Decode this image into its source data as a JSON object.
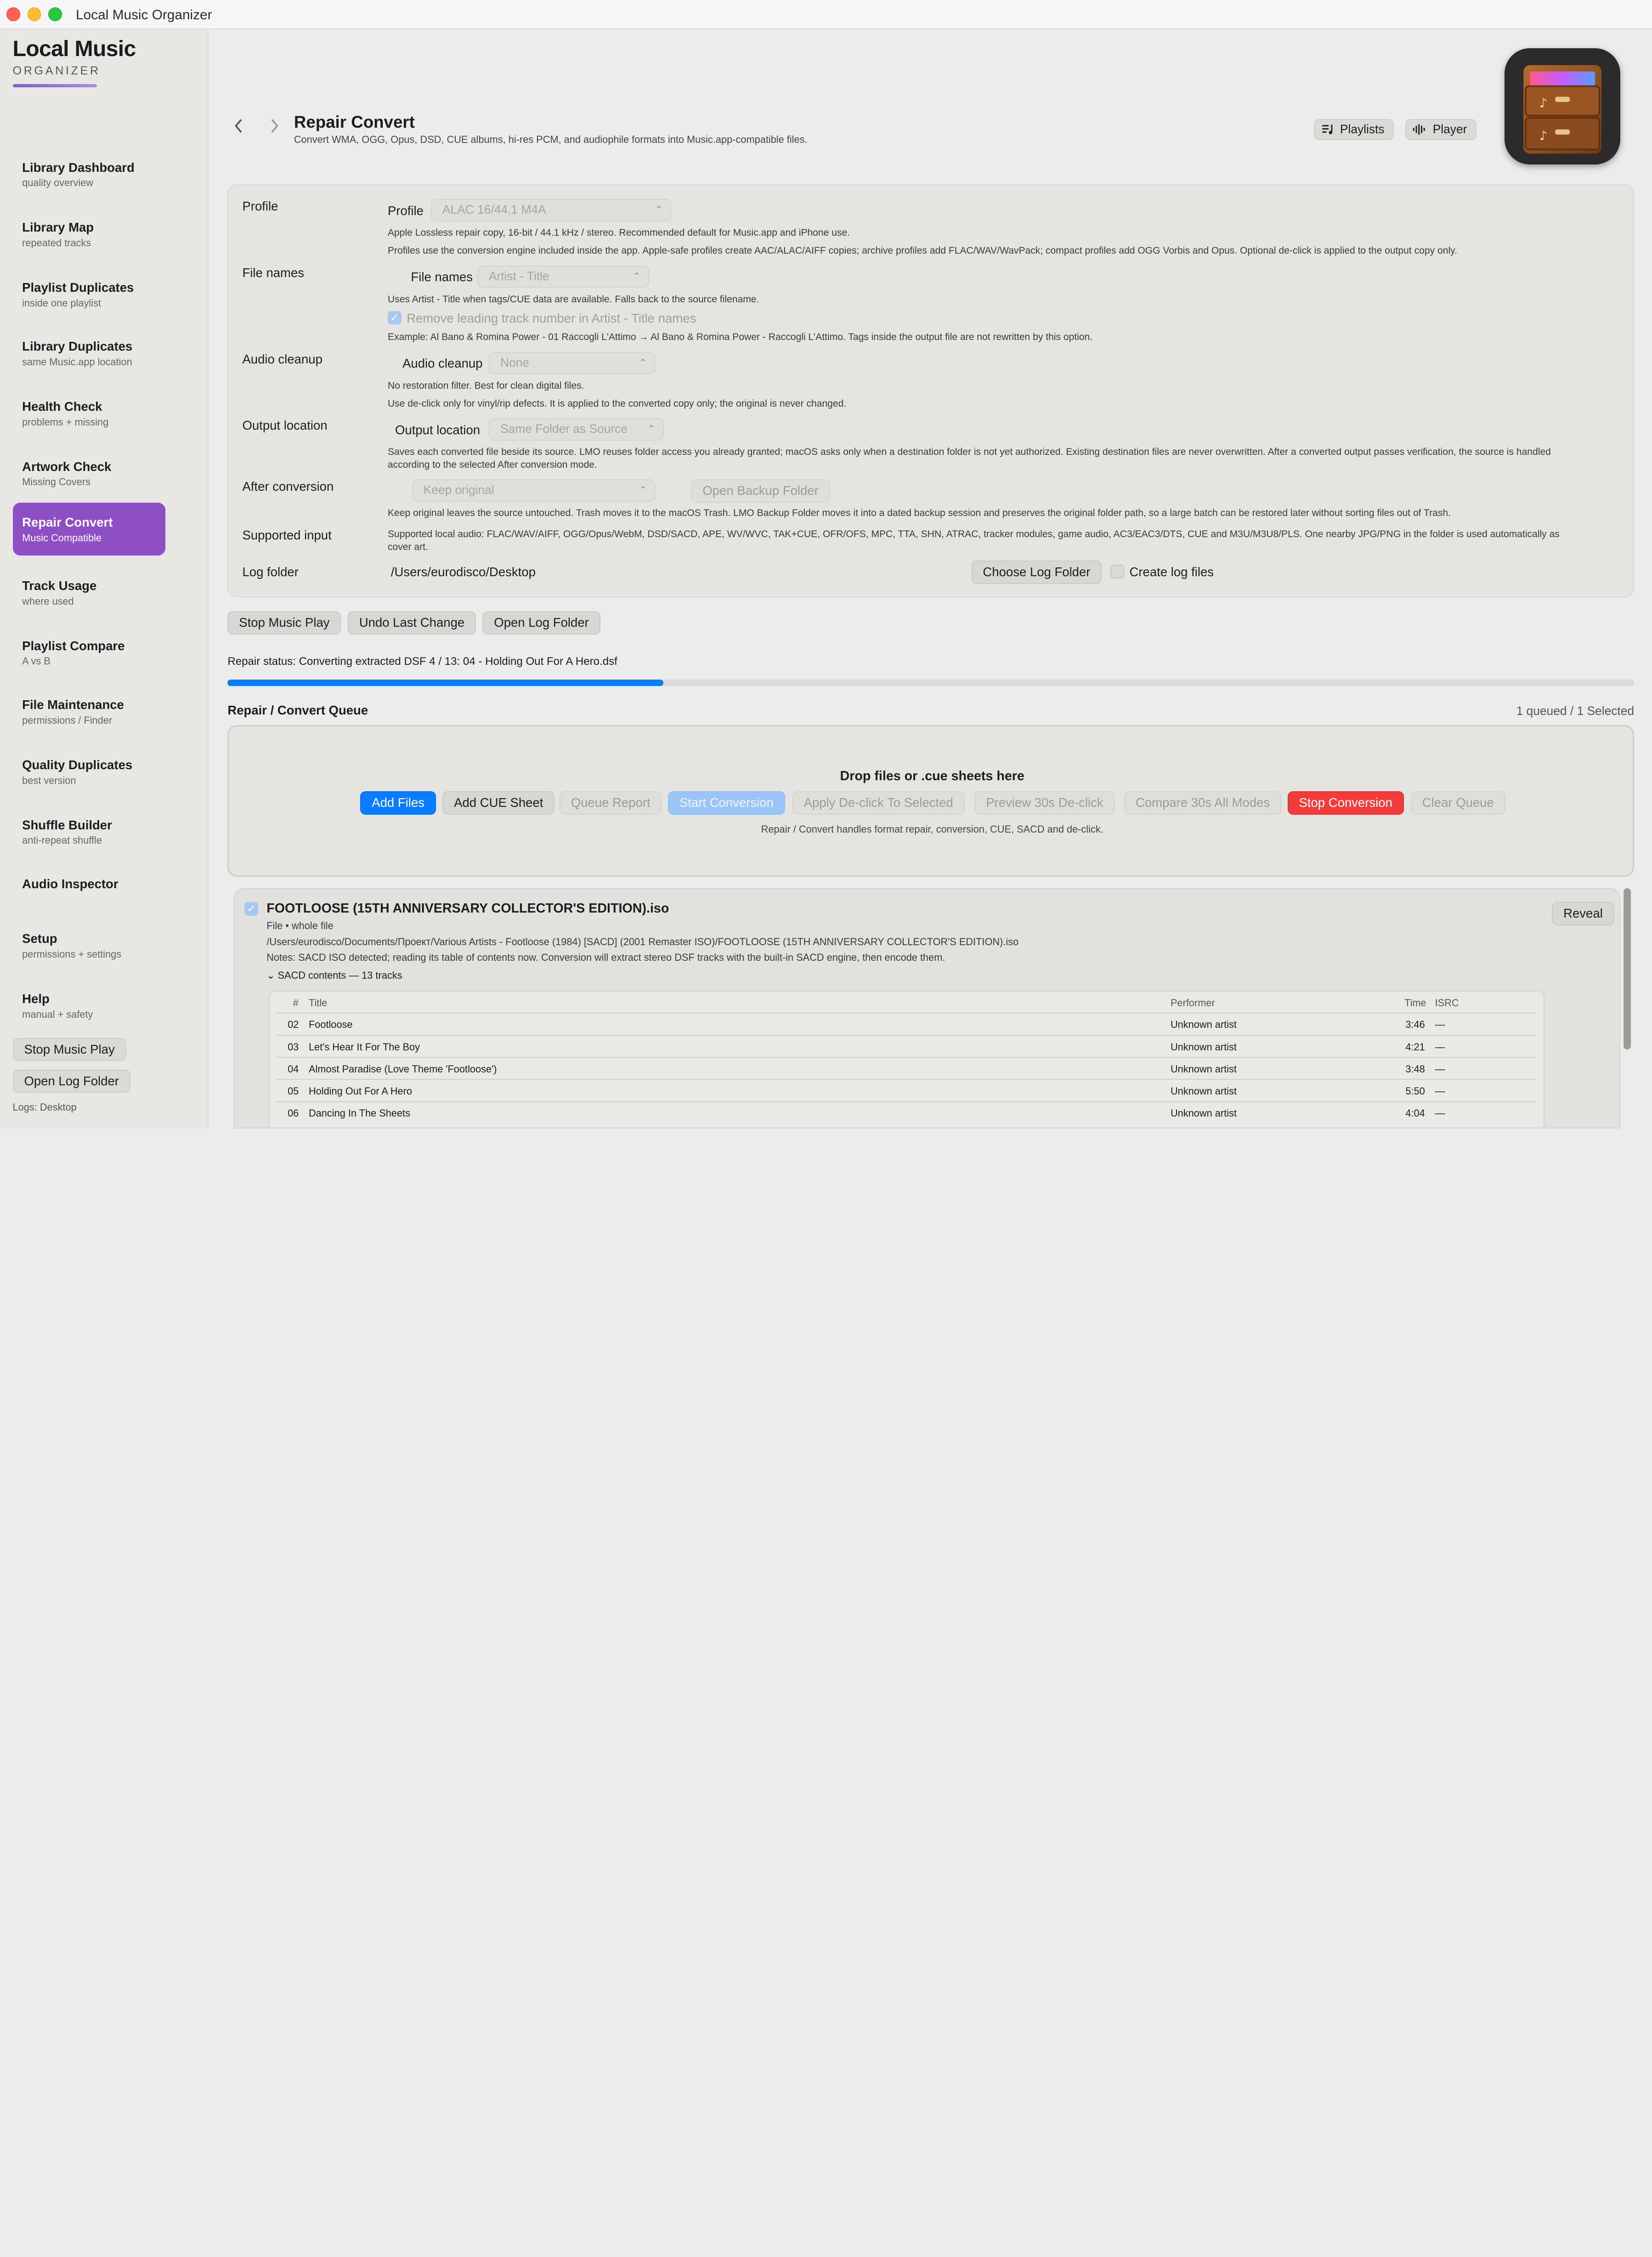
{
  "window": {
    "title": "Local Music Organizer"
  },
  "brand": {
    "line1": "Local Music",
    "line2": "ORGANIZER"
  },
  "sidebar": {
    "items": [
      {
        "title": "Library Dashboard",
        "sub": "quality overview"
      },
      {
        "title": "Library Map",
        "sub": "repeated tracks"
      },
      {
        "title": "Playlist Duplicates",
        "sub": "inside one playlist"
      },
      {
        "title": "Library Duplicates",
        "sub": "same Music.app location"
      },
      {
        "title": "Health Check",
        "sub": "problems + missing"
      },
      {
        "title": "Artwork Check",
        "sub": "Missing Covers"
      },
      {
        "title": "Repair Convert",
        "sub": "Music Compatible"
      },
      {
        "title": "Track Usage",
        "sub": "where used"
      },
      {
        "title": "Playlist Compare",
        "sub": "A vs B"
      },
      {
        "title": "File Maintenance",
        "sub": "permissions / Finder"
      },
      {
        "title": "Quality Duplicates",
        "sub": "best version"
      },
      {
        "title": "Shuffle Builder",
        "sub": "anti-repeat shuffle"
      },
      {
        "title": "Audio Inspector",
        "sub": ""
      },
      {
        "title": "Setup",
        "sub": "permissions + settings"
      },
      {
        "title": "Help",
        "sub": "manual + safety"
      }
    ],
    "stop_music": "Stop Music Play",
    "open_log": "Open Log Folder",
    "logs": "Logs: Desktop"
  },
  "header": {
    "title": "Repair Convert",
    "subtitle": "Convert WMA, OGG, Opus, DSD, CUE albums, hi-res PCM, and audiophile formats into Music.app-compatible files.",
    "playlists": "Playlists",
    "player": "Player"
  },
  "settings": {
    "profile": {
      "row": "Profile",
      "label": "Profile",
      "value": "ALAC 16/44.1 M4A",
      "help1": "Apple Lossless repair copy, 16-bit / 44.1 kHz / stereo. Recommended default for Music.app and iPhone use.",
      "help2": "Profiles use the conversion engine included inside the app. Apple-safe profiles create AAC/ALAC/AIFF copies; archive profiles add FLAC/WAV/WavPack; compact profiles add OGG Vorbis and Opus. Optional de-click is applied to the output copy only."
    },
    "filenames": {
      "row": "File names",
      "label": "File names",
      "value": "Artist - Title",
      "help1": "Uses Artist - Title when tags/CUE data are available. Falls back to the source filename.",
      "check": "Remove leading track number in Artist - Title names",
      "help2": "Example: Al Bano & Romina Power - 01 Raccogli L'Attimo → Al Bano & Romina Power - Raccogli L'Attimo. Tags inside the output file are not rewritten by this option."
    },
    "cleanup": {
      "row": "Audio cleanup",
      "label": "Audio cleanup",
      "value": "None",
      "help1": "No restoration filter. Best for clean digital files.",
      "help2": "Use de-click only for vinyl/rip defects. It is applied to the converted copy only; the original is never changed."
    },
    "output": {
      "row": "Output location",
      "label": "Output location",
      "value": "Same Folder as Source",
      "help": "Saves each converted file beside its source. LMO reuses folder access you already granted; macOS asks only when a destination folder is not yet authorized. Existing destination files are never overwritten. After a converted output passes verification, the source is handled according to the selected After conversion mode."
    },
    "after": {
      "row": "After conversion",
      "value": "Keep original",
      "button": "Open Backup Folder",
      "help": "Keep original leaves the source untouched. Trash moves it to the macOS Trash. LMO Backup Folder moves it into a dated backup session and preserves the original folder path, so a large batch can be restored later without sorting files out of Trash."
    },
    "supported": {
      "row": "Supported input",
      "help": "Supported local audio: FLAC/WAV/AIFF, OGG/Opus/WebM, DSD/SACD, APE, WV/WVC, TAK+CUE, OFR/OFS, MPC, TTA, SHN, ATRAC, tracker modules, game audio, AC3/EAC3/DTS, CUE and M3U/M3U8/PLS. One nearby JPG/PNG in the folder is used automatically as cover art."
    },
    "log": {
      "row": "Log folder",
      "path": "/Users/eurodisco/Desktop",
      "choose": "Choose Log Folder",
      "create": "Create log files"
    }
  },
  "actions": {
    "stop": "Stop Music Play",
    "undo": "Undo Last Change",
    "open_log": "Open Log Folder"
  },
  "status": {
    "text": "Repair status: Converting extracted DSF 4 / 13: 04 - Holding Out For A Hero.dsf",
    "progress": 0.31
  },
  "queue": {
    "title": "Repair / Convert Queue",
    "count": "1 queued / 1 Selected",
    "drop_title": "Drop files or .cue sheets here",
    "buttons": {
      "add_files": "Add Files",
      "add_cue": "Add CUE Sheet",
      "report": "Queue Report",
      "start": "Start Conversion",
      "declick": "Apply De-click To Selected",
      "preview": "Preview 30s De-click",
      "compare": "Compare 30s All Modes",
      "stop": "Stop Conversion",
      "clear": "Clear Queue"
    },
    "note": "Repair / Convert handles format repair, conversion, CUE, SACD and de-click."
  },
  "item": {
    "title": "FOOTLOOSE (15TH ANNIVERSARY COLLECTOR'S EDITION).iso",
    "kind": "File • whole file",
    "path": "/Users/eurodisco/Documents/Проект/Various Artists - Footloose (1984) [SACD] (2001 Remaster ISO)/FOOTLOOSE (15TH ANNIVERSARY COLLECTOR'S EDITION).iso",
    "notes": "Notes: SACD ISO detected; reading its table of contents now. Conversion will extract stereo DSF tracks with the built-in SACD engine, then encode them.",
    "contents": "SACD contents — 13 tracks",
    "reveal": "Reveal",
    "columns": {
      "num": "#",
      "title": "Title",
      "performer": "Performer",
      "time": "Time",
      "isrc": "ISRC"
    },
    "tracks": [
      {
        "num": "02",
        "title": "Footloose",
        "performer": "Unknown artist",
        "time": "3:46",
        "isrc": "—"
      },
      {
        "num": "03",
        "title": "Let's Hear It For The Boy",
        "performer": "Unknown artist",
        "time": "4:21",
        "isrc": "—"
      },
      {
        "num": "04",
        "title": "Almost Paradise (Love Theme 'Footloose')",
        "performer": "Unknown artist",
        "time": "3:48",
        "isrc": "—"
      },
      {
        "num": "05",
        "title": "Holding Out For A Hero",
        "performer": "Unknown artist",
        "time": "5:50",
        "isrc": "—"
      },
      {
        "num": "06",
        "title": "Dancing In The Sheets",
        "performer": "Unknown artist",
        "time": "4:04",
        "isrc": "—"
      }
    ]
  },
  "colors": {
    "accent": "#0a7cff",
    "sidebar_active": "#8e4fc4",
    "danger": "#f23c3c"
  }
}
